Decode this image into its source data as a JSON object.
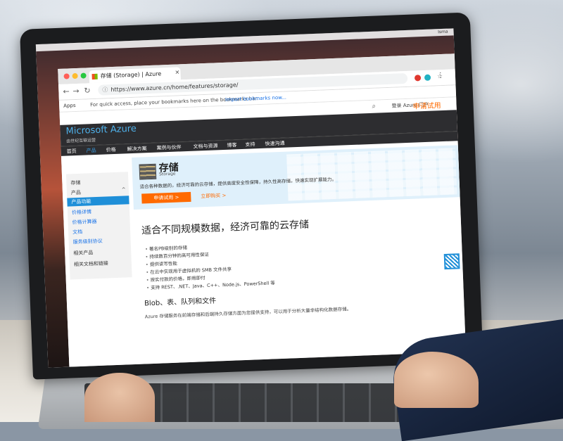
{
  "macos": {
    "user": "Isma"
  },
  "browser": {
    "tab_title": "存储 (Storage) | Azure",
    "url": "https://www.azure.cn/home/features/storage/",
    "bookmarks_apps": "Apps",
    "bookmarks_hint": "For quick access, place your bookmarks here on the bookmarks bar.",
    "bookmarks_import": "Import bookmarks now..."
  },
  "azure_header": {
    "portal": "登录 Azure 门户",
    "trial": "申请试用",
    "brand": "Microsoft Azure",
    "brand_sub": "由世纪互联运营",
    "nav": [
      "首页",
      "产品",
      "价格",
      "解决方案",
      "案例与伙伴",
      "文档与资源",
      "博客",
      "支持",
      "快速沟通"
    ]
  },
  "hero": {
    "title": "存储",
    "subtitle": "Storage",
    "desc": "适合各种数据的，经济可靠的云存储，提供高度安全性保障，持久性高存储，快速实现扩展能力。",
    "button": "申请试用 >",
    "link": "立即购买 >"
  },
  "sidebar": {
    "section": "存储",
    "product": "产品",
    "items": [
      "产品功能",
      "价格详情",
      "价格计算器",
      "文档",
      "服务级别协议"
    ],
    "related": "相关产品",
    "related2": "相关文档和链接"
  },
  "main": {
    "title": "适合不同规模数据，经济可靠的云存储",
    "bullets": [
      "著名PB级别的存储",
      "持续数百分钟的高可用性保证",
      "提供读写性能",
      "在云中实现用于虚拟机的 SMB 文件共享",
      "按实付款的价格，即用即付",
      "支持 REST、.NET、Java、C++、Node.js、PowerShell 等"
    ],
    "subhead": "Blob、表、队列和文件",
    "para": "Azure 存储服务在前端存储和后端持久存储方面为您提供支持，可以用于分析大量非结构化数据存储。"
  },
  "colors": {
    "accent": "#1f8fd8",
    "trial": "#ff6a00",
    "header": "#2d2d30"
  }
}
